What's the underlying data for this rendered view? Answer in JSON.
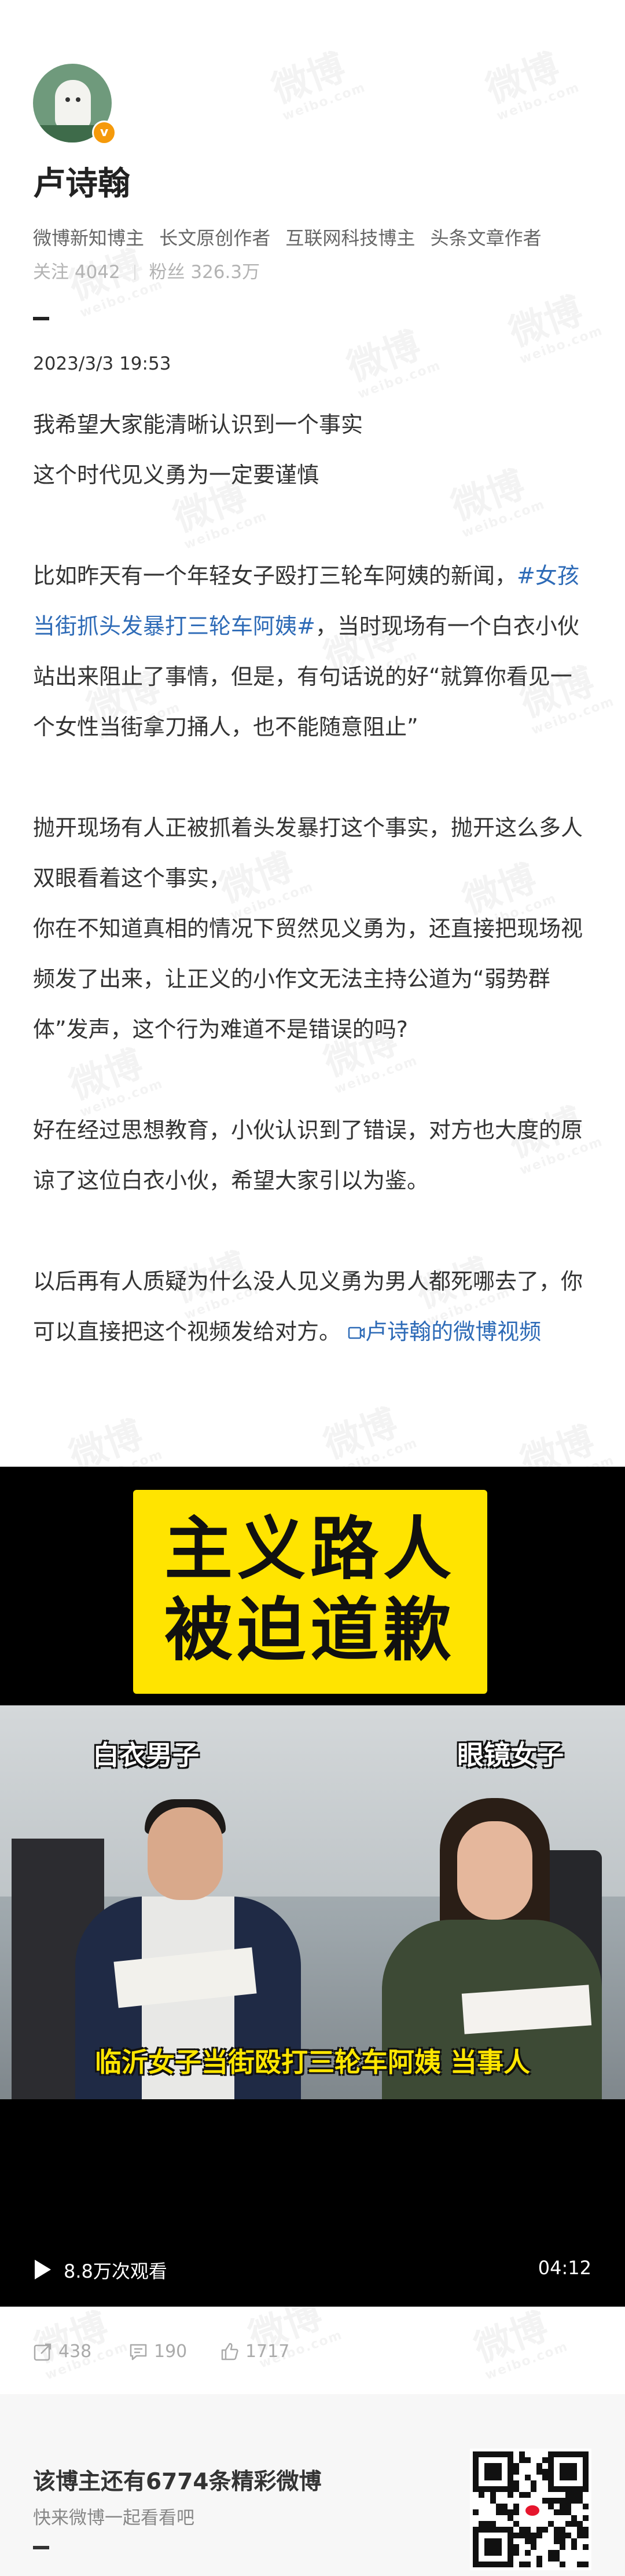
{
  "profile": {
    "name": "卢诗翰",
    "badge_glyph": "v",
    "verified_tags": [
      "微博新知博主",
      "长文原创作者",
      "互联网科技博主",
      "头条文章作者"
    ],
    "follow_label": "关注",
    "follow_count": "4042",
    "fans_label": "粉丝",
    "fans_count": "326.3万"
  },
  "post": {
    "date": "2023/3/3 19:53",
    "line1": "我希望大家能清晰认识到一个事实",
    "line2": "这个时代见义勇为一定要谨慎",
    "p2_a": "比如昨天有一个年轻女子殴打三轮车阿姨的新闻，",
    "p2_topic": "#女孩当街抓头发暴打三轮车阿姨#",
    "p2_b": "，当时现场有一个白衣小伙站出来阻止了事情，但是，有句话说的好“就算你看见一个女性当街拿刀捅人，也不能随意阻止”",
    "p3_a": "抛开现场有人正被抓着头发暴打这个事实，抛开这么多人双眼看着这个事实，",
    "p3_b": "你在不知道真相的情况下贸然见义勇为，还直接把现场视频发了出来，让正义的小作文无法主持公道为“弱势群体”发声，这个行为难道不是错误的吗?",
    "p4": "好在经过思想教育，小伙认识到了错误，对方也大度的原谅了这位白衣小伙，希望大家引以为鉴。",
    "p5": "以后再有人质疑为什么没人见义勇为男人都死哪去了，你可以直接把这个视频发给对方。",
    "video_link": "卢诗翰的微博视频"
  },
  "video": {
    "title_line1": "主义路人",
    "title_line2": "被迫道歉",
    "label_left": "白衣男子",
    "label_right": "眼镜女子",
    "caption": "临沂女子当街殴打三轮车阿姨 当事人",
    "views": "8.8万次观看",
    "duration": "04:12"
  },
  "actions": {
    "reposts": "438",
    "comments": "190",
    "likes": "1717"
  },
  "promo": {
    "title": "该博主还有6774条精彩微博",
    "subtitle": "快来微博一起看看吧"
  },
  "watermark": {
    "text": "微博",
    "sub": "weibo.com"
  },
  "colors": {
    "link": "#2e6bb7",
    "badge": "#f59a0b",
    "video_title_bg": "#ffe400",
    "caption": "#ffe600"
  }
}
